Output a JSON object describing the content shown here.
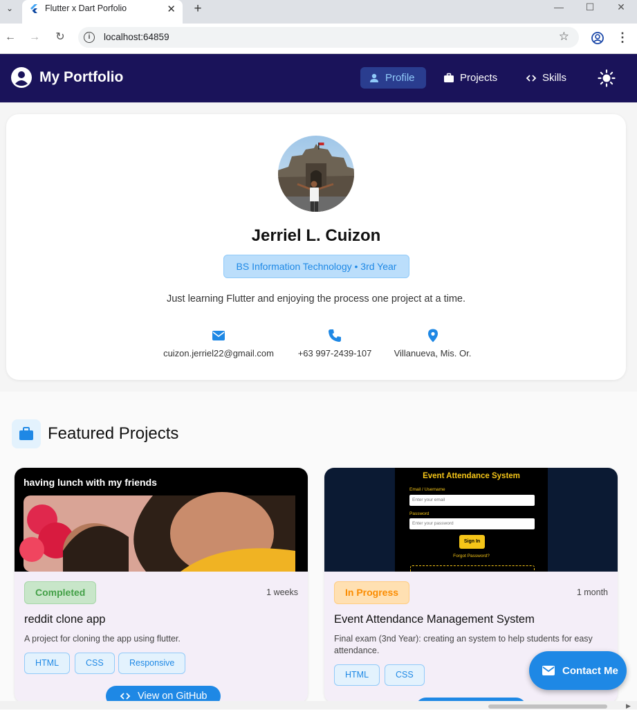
{
  "browser": {
    "tab_title": "Flutter x Dart Porfolio",
    "url": "localhost:64859"
  },
  "appbar": {
    "title": "My Portfolio",
    "nav": [
      {
        "label": "Profile",
        "icon": "person-icon",
        "active": true
      },
      {
        "label": "Projects",
        "icon": "briefcase-icon",
        "active": false
      },
      {
        "label": "Skills",
        "icon": "code-icon",
        "active": false
      }
    ],
    "theme_icon": "sun-icon"
  },
  "profile": {
    "name": "Jerriel L. Cuizon",
    "program": "BS Information Technology • 3rd Year",
    "tagline": "Just learning Flutter and enjoying the process one project at a time.",
    "contacts": [
      {
        "icon": "email-icon",
        "text": "cuizon.jerriel22@gmail.com"
      },
      {
        "icon": "phone-icon",
        "text": "+63 997-2439-107"
      },
      {
        "icon": "location-icon",
        "text": "Villanueva, Mis. Or."
      }
    ]
  },
  "projects": {
    "title": "Featured Projects",
    "items": [
      {
        "image_caption": "having lunch with my friends",
        "status": "Completed",
        "duration": "1 weeks",
        "title": "reddit clone app",
        "description": "A project for cloning the app using flutter.",
        "tags": [
          "HTML",
          "CSS",
          "Responsive"
        ],
        "button": "View on GitHub"
      },
      {
        "image_screen": {
          "title": "Event Attendance System",
          "email_label": "Email / Username",
          "email_placeholder": "Enter your email",
          "password_label": "Password",
          "password_placeholder": "Enter your password",
          "signin": "Sign In",
          "forgot": "Forgot Password?"
        },
        "status": "In Progress",
        "duration": "1 month",
        "title": "Event Attendance Management System",
        "description": "Final exam (3nd Year): creating an system to help students for easy attendance.",
        "tags": [
          "HTML",
          "CSS"
        ]
      }
    ]
  },
  "fab": {
    "label": "Contact Me"
  },
  "colors": {
    "appbar": "#1a135a",
    "accent": "#1e88e5"
  }
}
